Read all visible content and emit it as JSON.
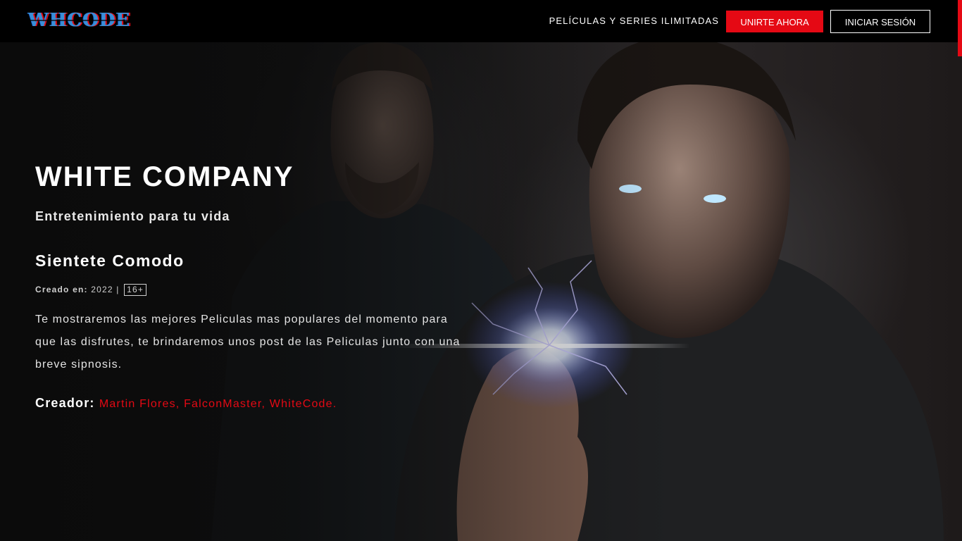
{
  "header": {
    "logo_text": "WHCODE",
    "tagline": "PELÍCULAS Y SERIES ILIMITADAS",
    "join_label": "UNIRTE AHORA",
    "login_label": "INICIAR SESIÓN"
  },
  "hero": {
    "title": "WHITE COMPANY",
    "subtitle": "Entretenimiento para tu vida",
    "heading": "Sientete Comodo",
    "meta": {
      "created_label": "Creado en:",
      "year": "2022",
      "separator": "|",
      "rating": "16+"
    },
    "description": "Te mostraremos las mejores Peliculas mas populares del momento para que las disfrutes, te brindaremos unos post de las Peliculas junto con una breve sipnosis.",
    "creator": {
      "label": "Creador:",
      "names": "Martin Flores, FalconMaster, WhiteCode."
    }
  },
  "colors": {
    "accent": "#e50914",
    "header_bg": "#000000",
    "text": "#ffffff"
  }
}
